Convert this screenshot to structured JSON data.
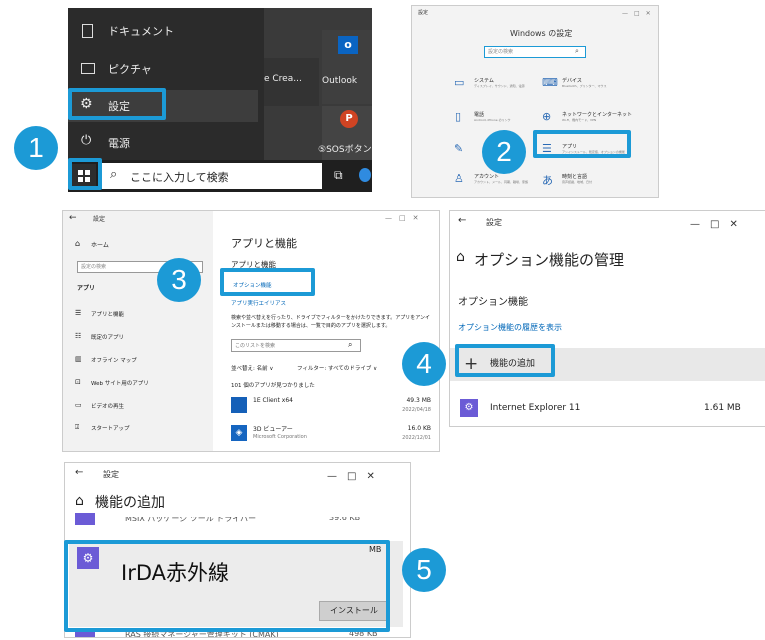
{
  "step1": {
    "badge": "1",
    "menu_items": [
      "ドキュメント",
      "ピクチャ",
      "設定",
      "電源"
    ],
    "tiles": {
      "creative": "e Crea...",
      "outlook": "Outlook",
      "sos": "⑤SOSボタン配"
    },
    "search_placeholder": "ここに入力して検索"
  },
  "step2": {
    "badge": "2",
    "window_label": "設定",
    "title": "Windows の設定",
    "search_placeholder": "設定の検索",
    "categories": [
      {
        "name": "システム",
        "desc": "ディスプレイ、サウンド、通知、電源"
      },
      {
        "name": "デバイス",
        "desc": "Bluetooth、プリンター、マウス"
      },
      {
        "name": "電話",
        "desc": "Android, iPhone のリンク"
      },
      {
        "name": "ネットワークとインターネット",
        "desc": "Wi-Fi、機内モード、VPN"
      },
      {
        "name": "",
        "desc": ""
      },
      {
        "name": "アプリ",
        "desc": "アンインストール、既定値、オプションの機能"
      },
      {
        "name": "アカウント",
        "desc": "アカウント、メール、同期、職場、家族"
      },
      {
        "name": "時刻と言語",
        "desc": "音声認識、地域、日付"
      }
    ]
  },
  "step3": {
    "badge": "3",
    "back": "←",
    "window_label": "設定",
    "home": "ホーム",
    "search_placeholder": "設定の検索",
    "section": "アプリ",
    "nav": [
      "アプリと機能",
      "既定のアプリ",
      "オフライン マップ",
      "Web サイト用のアプリ",
      "ビデオの再生",
      "スタートアップ"
    ],
    "page_title": "アプリと機能",
    "subtitle": "アプリと機能",
    "link_optional": "オプション機能",
    "link_alias": "アプリ実行エイリアス",
    "description": "検索や並べ替えを行ったり、ドライブでフィルターをかけたりできます。アプリをアンインストールまたは移動する場合は、一覧で目的のアプリを選択します。",
    "list_search_placeholder": "このリストを検索",
    "sort": "並べ替え: 名前 ∨",
    "filter": "フィルター: すべてのドライブ ∨",
    "count": "101 個のアプリが見つかりました",
    "apps": [
      {
        "name": "1E Client x64",
        "publisher": "",
        "size": "49.3 MB",
        "date": "2022/04/18"
      },
      {
        "name": "3D ビューアー",
        "publisher": "Microsoft Corporation",
        "size": "16.0 KB",
        "date": "2022/12/01"
      }
    ]
  },
  "step4": {
    "badge": "4",
    "back": "←",
    "window_label": "設定",
    "page_title": "オプション機能の管理",
    "section": "オプション機能",
    "history_link": "オプション機能の履歴を表示",
    "add_button": "機能の追加",
    "feature": {
      "name": "Internet Explorer 11",
      "size": "1.61 MB"
    }
  },
  "step5": {
    "badge": "5",
    "back": "←",
    "window_label": "設定",
    "page_title": "機能の追加",
    "items": [
      {
        "name": "MSIX パッケージ ツール ドライバー",
        "size": "39.6 KB"
      },
      {
        "name": "IrDA赤外線",
        "size": "MB"
      },
      {
        "name": "RAS 接続マネージャー管理キット (CMAK)",
        "size": "498 KB"
      }
    ],
    "install_button": "インストール"
  },
  "colors": {
    "accent": "#1c9ad6",
    "link": "#0067b8",
    "icon": "#2a6ab5",
    "puzzle": "#6b5bd6"
  }
}
